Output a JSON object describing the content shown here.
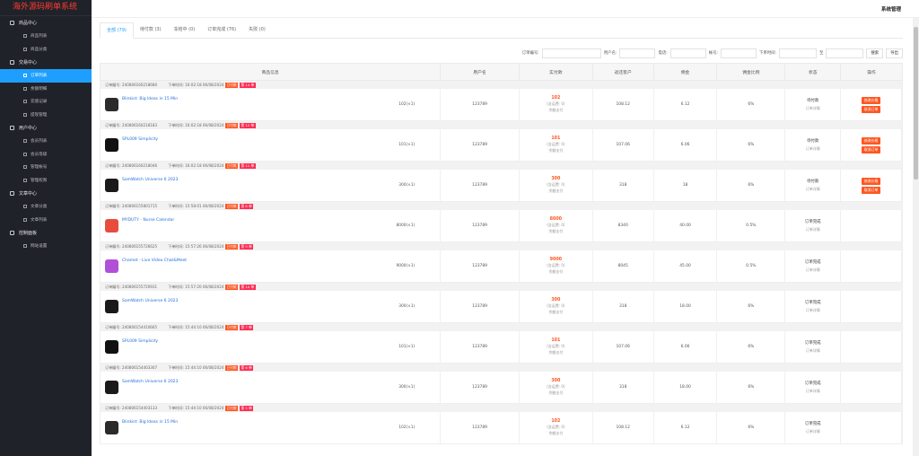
{
  "brand": "海外源码刷单系统",
  "header": {
    "title": "系统管理"
  },
  "sidebar": [
    {
      "group": "商品中心",
      "items": [
        {
          "label": "商品列表",
          "active": false
        },
        {
          "label": "商品分类",
          "active": false
        }
      ]
    },
    {
      "group": "交易中心",
      "items": [
        {
          "label": "订单列表",
          "active": true
        },
        {
          "label": "余额明细",
          "active": false
        },
        {
          "label": "充值记录",
          "active": false
        },
        {
          "label": "提现管理",
          "active": false
        }
      ]
    },
    {
      "group": "用户中心",
      "items": [
        {
          "label": "会员列表",
          "active": false
        },
        {
          "label": "会员等级",
          "active": false
        },
        {
          "label": "管理帐号",
          "active": false
        },
        {
          "label": "管理权限",
          "active": false
        }
      ]
    },
    {
      "group": "文章中心",
      "items": [
        {
          "label": "文章分类",
          "active": false
        },
        {
          "label": "文章列表",
          "active": false
        }
      ]
    },
    {
      "group": "控制面板",
      "items": [
        {
          "label": "网站设置",
          "active": false
        }
      ]
    }
  ],
  "tabs": [
    {
      "label": "全部 (79)",
      "active": true
    },
    {
      "label": "待付款 (3)",
      "active": false
    },
    {
      "label": "冻结中 (0)",
      "active": false
    },
    {
      "label": "订单完成 (76)",
      "active": false
    },
    {
      "label": "失败 (0)",
      "active": false
    }
  ],
  "filters": {
    "order_no_label": "订单编号:",
    "user_label": "用户名:",
    "phone_label": "电话:",
    "account_label": "帐号:",
    "time_label": "下单时间:",
    "to_label": "至",
    "search_label": "搜索",
    "export_label": "导出"
  },
  "columns": [
    "商品信息",
    "用户名",
    "实付款",
    "返还客户",
    "佣金",
    "佣金比例",
    "状态",
    "操作"
  ],
  "orders": [
    {
      "no": "订单编号: 240806160218680",
      "time": "下单时间: 16:02:18 06/08/2024",
      "b1": "已付款",
      "b2": "第 14 单",
      "product": "Blinkist: Big Ideas in 15 Min",
      "thumb": "#2b2b2b",
      "qty": "102(×1)",
      "user": "123789",
      "pay": "102",
      "pay_sub1": "(含运费: 0)",
      "pay_sub2": "余额支付",
      "ret": "108.12",
      "comm": "6.12",
      "rate": "6%",
      "status": "待付款",
      "status_link": "订单详情",
      "ops": [
        "修改价格",
        "取消订单"
      ]
    },
    {
      "no": "订单编号: 240806160218183",
      "time": "下单时间: 16:02:18 06/08/2024",
      "b1": "已付款",
      "b2": "第 12 单",
      "product": "SPL009 Simplicity",
      "thumb": "#111111",
      "qty": "101(×1)",
      "user": "123789",
      "pay": "101",
      "pay_sub1": "(含运费: 0)",
      "pay_sub2": "余额支付",
      "ret": "107.06",
      "comm": "6.06",
      "rate": "6%",
      "status": "待付款",
      "status_link": "订单详情",
      "ops": [
        "修改价格",
        "取消订单"
      ]
    },
    {
      "no": "订单编号: 240806160218046",
      "time": "下单时间: 16:02:18 06/08/2024",
      "b1": "已付款",
      "b2": "第 11 单",
      "product": "SamWatch Universe 6 2023",
      "thumb": "#1a1a1a",
      "qty": "300(×1)",
      "user": "123789",
      "pay": "300",
      "pay_sub1": "(含运费: 0)",
      "pay_sub2": "余额支付",
      "ret": "318",
      "comm": "18",
      "rate": "6%",
      "status": "待付款",
      "status_link": "订单详情",
      "ops": [
        "修改价格",
        "取消订单"
      ]
    },
    {
      "no": "订单编号: 240806155801715",
      "time": "下单时间: 15:58:01 06/08/2024",
      "b1": "已付款",
      "b2": "第 8 单",
      "product": "MYDUTY - Nurse Calendar",
      "thumb": "#e84c3d",
      "qty": "8000(×1)",
      "user": "123789",
      "pay": "8000",
      "pay_sub1": "(含运费: 0)",
      "pay_sub2": "余额支付",
      "ret": "8340",
      "comm": "40.00",
      "rate": "0.5%",
      "status": "订单完成",
      "status_link": "订单详情",
      "ops": []
    },
    {
      "no": "订单编号: 240806155726625",
      "time": "下单时间: 15:57:26 06/08/2024",
      "b1": "已付款",
      "b2": "第 9 单",
      "product": "Chamet - Live Video Chat&amp;Meet",
      "thumb": "#b24fd8",
      "qty": "9000(×1)",
      "user": "123789",
      "pay": "9000",
      "pay_sub1": "(含运费: 0)",
      "pay_sub2": "余额支付",
      "ret": "8045",
      "comm": "45.00",
      "rate": "0.5%",
      "status": "订单完成",
      "status_link": "订单详情",
      "ops": []
    },
    {
      "no": "订单编号: 240806155720931",
      "time": "下单时间: 15:57:20 06/08/2024",
      "b1": "已付款",
      "b2": "第 10 单",
      "product": "SamWatch Universe 6 2023",
      "thumb": "#1a1a1a",
      "qty": "300(×1)",
      "user": "123789",
      "pay": "300",
      "pay_sub1": "(含运费: 0)",
      "pay_sub2": "余额支付",
      "ret": "318",
      "comm": "18.00",
      "rate": "6%",
      "status": "订单完成",
      "status_link": "订单详情",
      "ops": []
    },
    {
      "no": "订单编号: 240806154410665",
      "time": "下单时间: 15:44:10 06/08/2024",
      "b1": "已付款",
      "b2": "第 7 单",
      "product": "SPL009 Simplicity",
      "thumb": "#111111",
      "qty": "101(×1)",
      "user": "123789",
      "pay": "101",
      "pay_sub1": "(含运费: 0)",
      "pay_sub2": "余额支付",
      "ret": "107.06",
      "comm": "6.06",
      "rate": "6%",
      "status": "订单完成",
      "status_link": "订单详情",
      "ops": []
    },
    {
      "no": "订单编号: 240806154403307",
      "time": "下单时间: 15:44:10 06/08/2024",
      "b1": "已付款",
      "b2": "第 6 单",
      "product": "SamWatch Universe 6 2023",
      "thumb": "#1a1a1a",
      "qty": "300(×1)",
      "user": "123789",
      "pay": "300",
      "pay_sub1": "(含运费: 0)",
      "pay_sub2": "余额支付",
      "ret": "318",
      "comm": "18.00",
      "rate": "6%",
      "status": "订单完成",
      "status_link": "订单详情",
      "ops": []
    },
    {
      "no": "订单编号: 240806154403133",
      "time": "下单时间: 15:44:10 06/08/2024",
      "b1": "已付款",
      "b2": "第 5 单",
      "product": "Blinkist: Big Ideas in 15 Min",
      "thumb": "#2b2b2b",
      "qty": "102(×1)",
      "user": "123789",
      "pay": "102",
      "pay_sub1": "(含运费: 0)",
      "pay_sub2": "余额支付",
      "ret": "108.12",
      "comm": "6.12",
      "rate": "6%",
      "status": "订单完成",
      "status_link": "订单详情",
      "ops": []
    }
  ]
}
